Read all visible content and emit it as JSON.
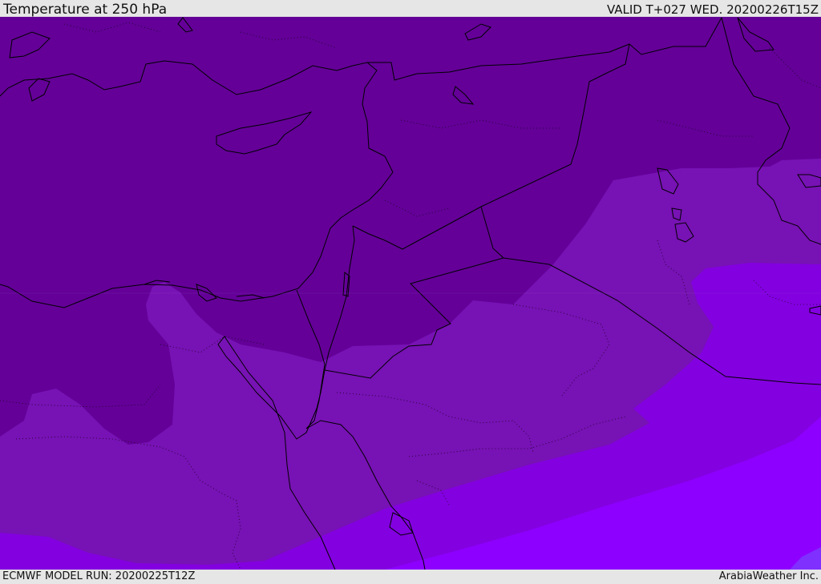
{
  "header": {
    "title": "Temperature at 250 hPa",
    "valid": "VALID T+027 WED. 20200226T15Z"
  },
  "footer": {
    "model_run": "ECMWF MODEL RUN: 20200225T12Z",
    "credit": "ArabiaWeather Inc."
  },
  "map": {
    "palette": {
      "band1": "#640098",
      "band2": "#7712b4",
      "band3": "#8300e0",
      "band4": "#8d00ff",
      "coast_color": "#000000",
      "border_color": "#000000"
    }
  }
}
